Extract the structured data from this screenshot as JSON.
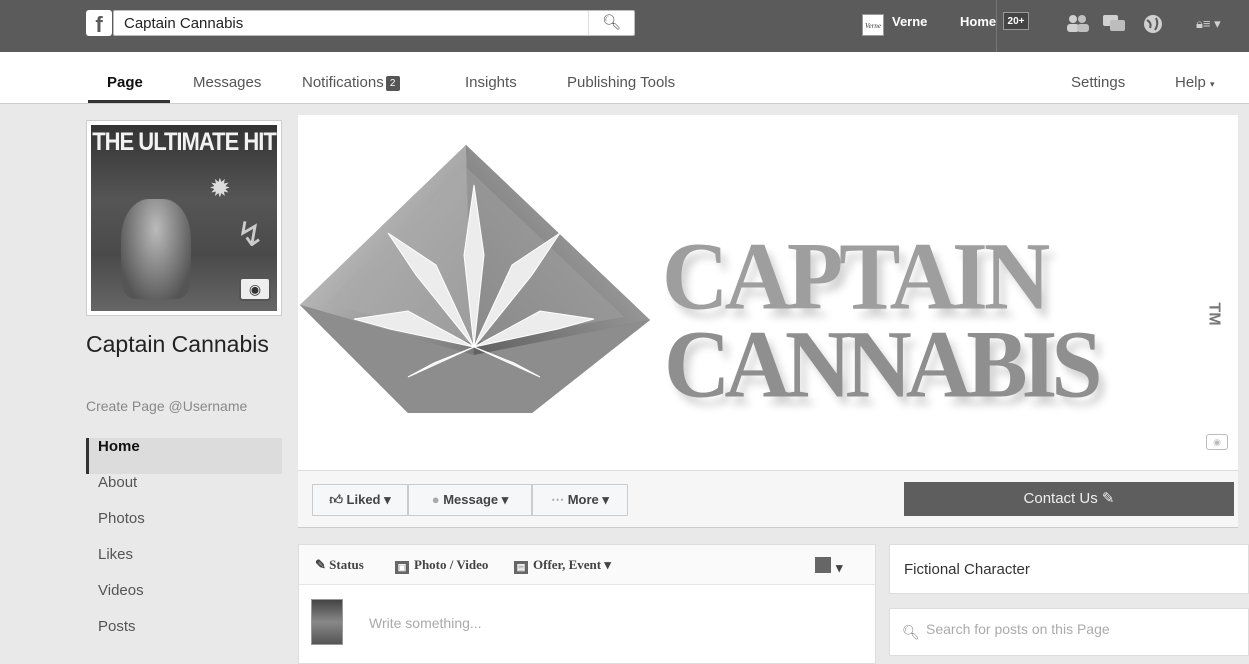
{
  "topbar": {
    "logo": "f",
    "search_value": "Captain Cannabis",
    "search_icon": "magnifier-icon",
    "avatar_text": "Verne",
    "user_name": "Verne",
    "home_label": "Home",
    "home_badge": "20+",
    "icons": [
      "friends-icon",
      "messages-icon",
      "globe-icon",
      "settings-icon"
    ]
  },
  "nav": {
    "tabs": [
      "Page",
      "Messages",
      "Notifications",
      "Insights",
      "Publishing Tools"
    ],
    "notifications_count": "2",
    "settings_label": "Settings",
    "help_label": "Help"
  },
  "profile": {
    "art_title": "THE ULTIMATE HIT",
    "name": "Captain Cannabis",
    "username_link": "Create Page @Username"
  },
  "sidebar": {
    "items": [
      "Home",
      "About",
      "Photos",
      "Likes",
      "Videos",
      "Posts"
    ],
    "active": "Home"
  },
  "cover": {
    "line1": "CAPTAIN",
    "line2": "CANNABIS",
    "tm": "TM"
  },
  "actions": {
    "liked": "Liked",
    "message": "Message",
    "more": "More",
    "contact": "Contact Us"
  },
  "composer": {
    "tabs": [
      "Status",
      "Photo / Video",
      "Offer, Event"
    ],
    "placeholder": "Write something..."
  },
  "right": {
    "category": "Fictional Character",
    "search_placeholder": "Search for posts on this Page"
  },
  "colors": {
    "topbar": "#5b5b5b",
    "contact_button": "#5e5e5e",
    "page_bg": "#e9e9e9"
  }
}
